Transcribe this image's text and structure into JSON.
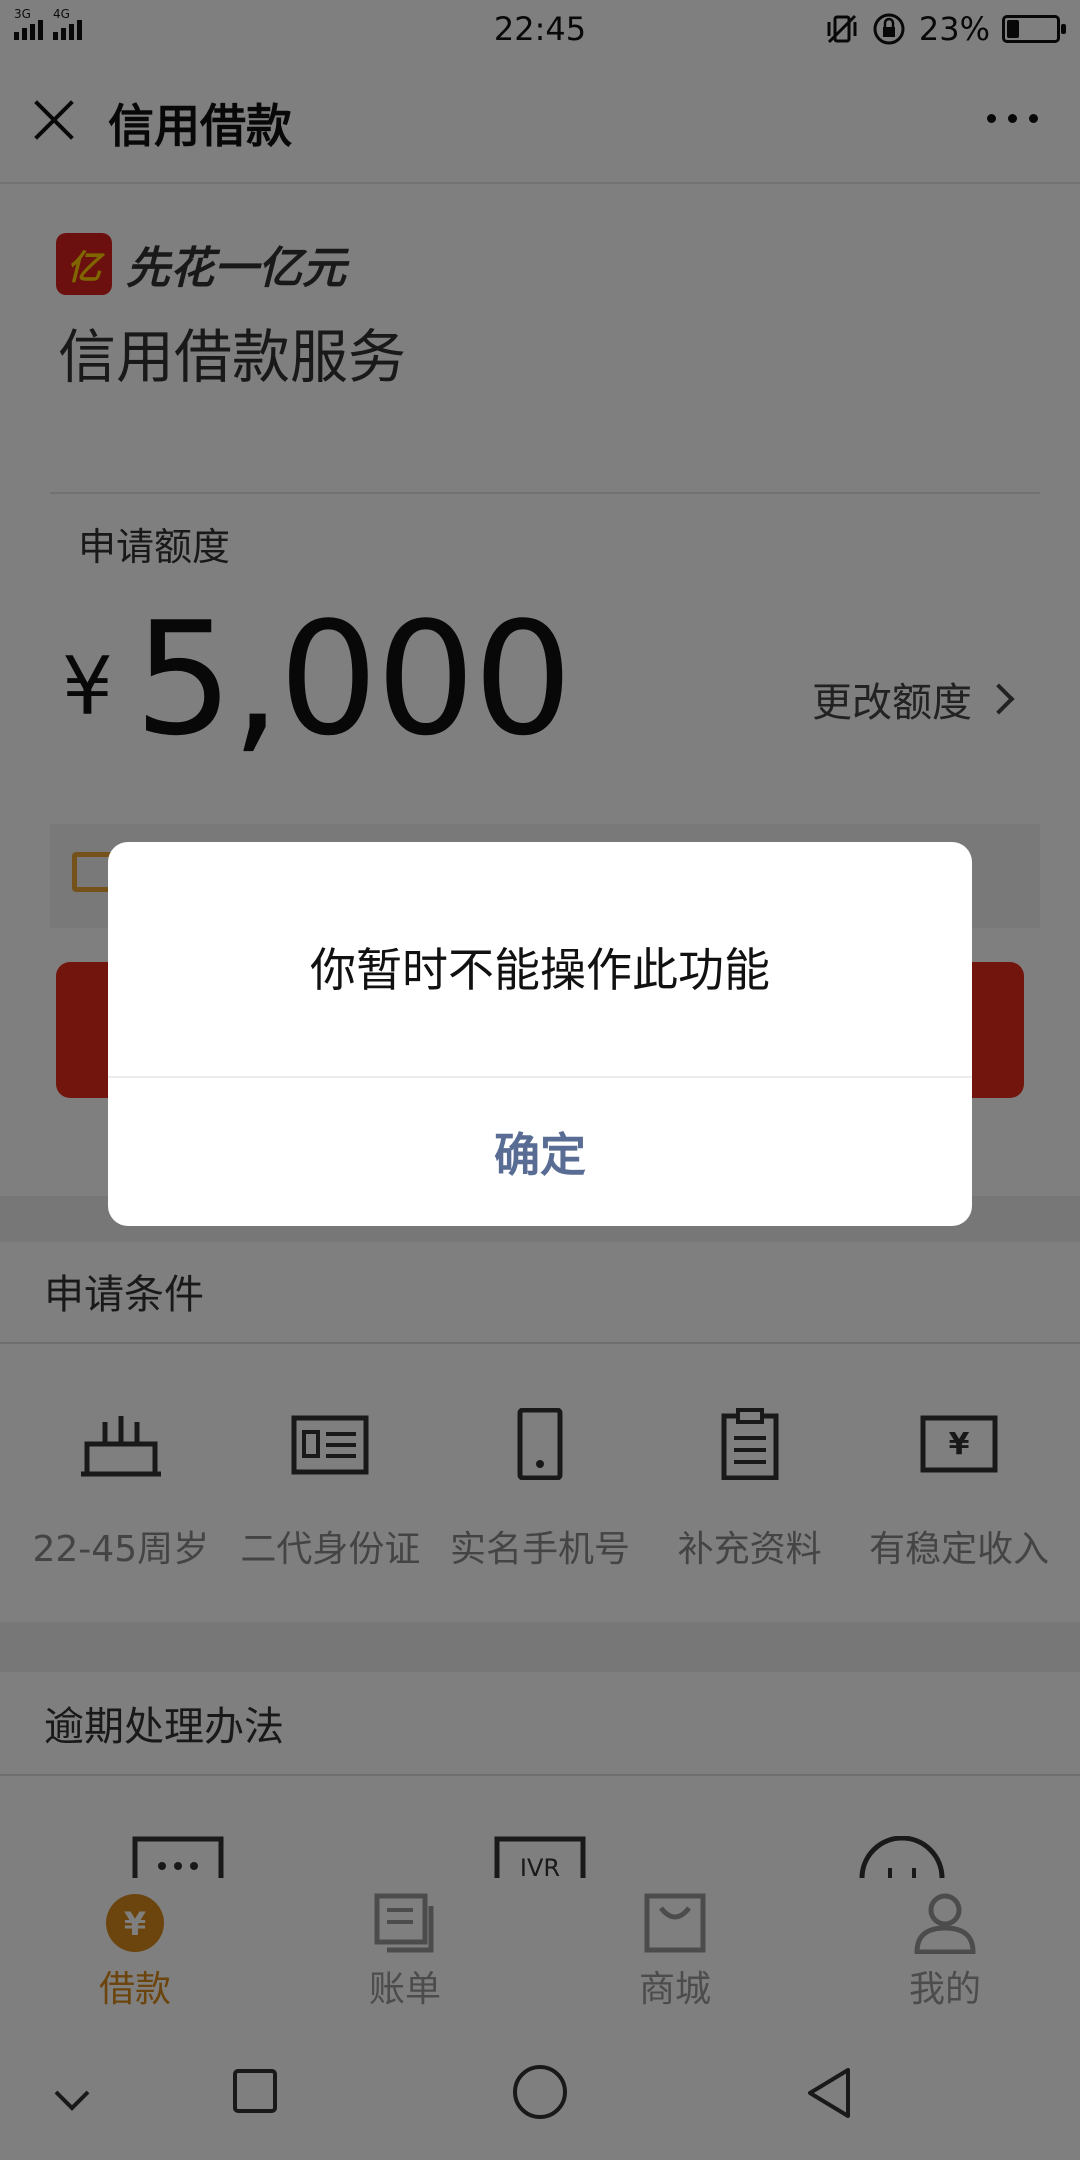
{
  "status_bar": {
    "network": [
      "3G",
      "4G"
    ],
    "time": "22:45",
    "battery_percent": "23%",
    "battery_level": 0.23
  },
  "nav": {
    "title": "信用借款"
  },
  "brand": {
    "logo_text": "亿",
    "name": "先花一亿元",
    "service_title": "信用借款服务"
  },
  "quota": {
    "label": "申请额度",
    "currency": "¥",
    "amount": "5,000",
    "change_label": "更改额度"
  },
  "conditions": {
    "title": "申请条件",
    "items": [
      {
        "label": "22-45周岁",
        "icon": "cake-icon"
      },
      {
        "label": "二代身份证",
        "icon": "id-card-icon"
      },
      {
        "label": "实名手机号",
        "icon": "phone-icon"
      },
      {
        "label": "补充资料",
        "icon": "clipboard-icon"
      },
      {
        "label": "有稳定收入",
        "icon": "yen-banknote-icon"
      }
    ]
  },
  "overdue": {
    "title": "逾期处理办法"
  },
  "tabs": [
    {
      "label": "借款",
      "icon": "yen-circle-icon",
      "active": true
    },
    {
      "label": "账单",
      "icon": "bill-icon",
      "active": false
    },
    {
      "label": "商城",
      "icon": "shopping-bag-icon",
      "active": false
    },
    {
      "label": "我的",
      "icon": "profile-icon",
      "active": false
    }
  ],
  "dialog": {
    "message": "你暂时不能操作此功能",
    "confirm_label": "确定"
  },
  "colors": {
    "accent_red": "#e52a18",
    "tab_active": "#d98b1d",
    "dialog_button": "#586c94"
  }
}
